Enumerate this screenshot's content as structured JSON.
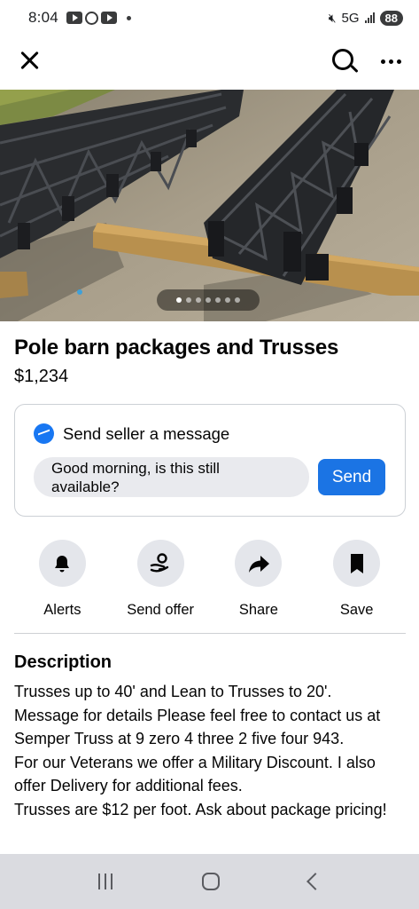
{
  "status_bar": {
    "time": "8:04",
    "network": "5G",
    "battery": "88",
    "icons": [
      "youtube-icon",
      "threads-icon",
      "youtube-icon",
      "notification-dot",
      "mute-icon",
      "signal-icon"
    ]
  },
  "nav": {
    "icons": [
      "close-icon",
      "search-icon",
      "more-icon"
    ]
  },
  "listing": {
    "photo_count": 7,
    "active_photo": 1,
    "title": "Pole barn packages and Trusses",
    "price": "$1,234"
  },
  "message": {
    "header": "Send seller a message",
    "input_value": "Good morning, is this still available?",
    "send_label": "Send",
    "accent_color": "#1b74e4"
  },
  "actions": [
    {
      "label": "Alerts",
      "icon": "bell-icon"
    },
    {
      "label": "Send offer",
      "icon": "offer-icon"
    },
    {
      "label": "Share",
      "icon": "share-arrow-icon"
    },
    {
      "label": "Save",
      "icon": "bookmark-icon"
    }
  ],
  "description": {
    "heading": "Description",
    "body": "Trusses up to 40' and Lean to Trusses to 20'.\nMessage for details Please feel free to contact us at Semper Truss at 9 zero 4 three 2 five  four 943.\nFor our Veterans we offer a Military Discount. I also offer Delivery for additional fees.\nTrusses are $12 per foot. Ask about package pricing!"
  },
  "system_nav": {
    "icons": [
      "recents-icon",
      "home-icon",
      "back-icon"
    ]
  }
}
